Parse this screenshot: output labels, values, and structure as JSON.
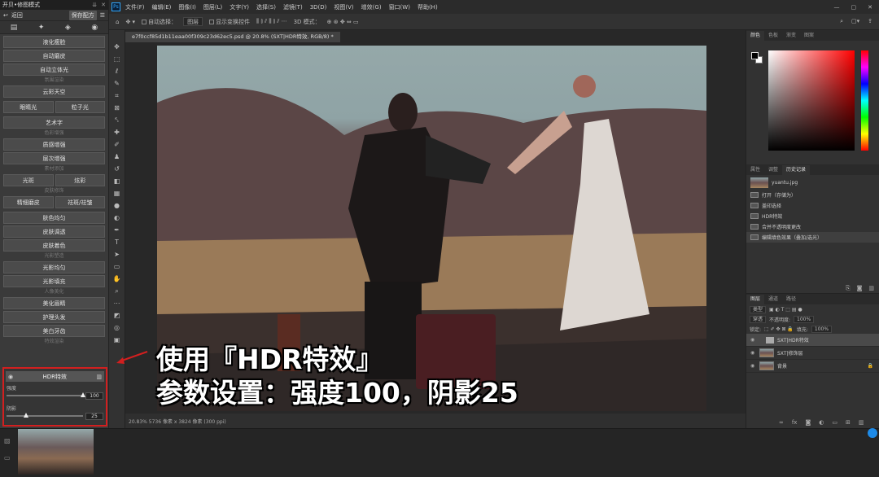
{
  "plugin": {
    "title": "开贝•修图模式",
    "back": "返回",
    "save": "保存配方",
    "buttons": {
      "liquify": "液化瘦脸",
      "auto_skin": "自动磨皮",
      "auto_3d": "自动立体光",
      "sec_atmosphere": "氛围渲染",
      "cloud_sky": "云彩天空",
      "eye_light": "眼睛光",
      "particle_light": "粒子光",
      "art_font": "艺术字",
      "sec_color": "色彩增强",
      "texture": "质感增强",
      "layer_enhance": "层次增强",
      "sec_material": "素材添加",
      "light_spot": "光斑",
      "confetti": "炫彩",
      "sec_skin": "皮肤修饰",
      "fine_skin": "精细磨皮",
      "remove_wrinkle": "祛斑/祛皱",
      "skin_even": "肤色均匀",
      "skin_tone": "皮肤调透",
      "skin_color": "皮肤着色",
      "sec_light": "光影塑造",
      "light_even": "光影均匀",
      "light_fill": "光影填充",
      "sec_portrait": "人像美化",
      "beautify_eyebrow": "美化眉睛",
      "hair_care": "护理头发",
      "whiten_teeth": "美白牙齿",
      "sec_effects": "特效渲染"
    },
    "hdr": {
      "title": "HDR特效",
      "strength_label": "强度",
      "strength_value": "100",
      "strength": 100,
      "shadow_label": "阴影",
      "shadow_value": "25",
      "shadow": 25
    }
  },
  "menu": {
    "items": [
      "文件(F)",
      "编辑(E)",
      "图像(I)",
      "图层(L)",
      "文字(Y)",
      "选择(S)",
      "滤镜(T)",
      "3D(D)",
      "视图(V)",
      "增效(G)",
      "窗口(W)",
      "帮助(H)"
    ]
  },
  "options": {
    "auto_select": "自动选择：",
    "group": "图层",
    "show_transform": "显示变换控件",
    "mode3d": "3D 模式："
  },
  "document": {
    "tab": "e7f0ccf85d1b11eaa00f309c23d62ec5.psd @ 20.8% (SXT|HDR特效, RGB/8) *",
    "status": "20.83%    5736 像素 x 3824 像素 (300 ppi)"
  },
  "caption": {
    "line1": "使用『HDR特效』",
    "line2": "参数设置：强度100，阴影25"
  },
  "panels": {
    "color_tabs": [
      "颜色",
      "色板",
      "渐变",
      "图案"
    ],
    "history_tabs": [
      "属性",
      "调整",
      "历史记录"
    ],
    "history_file": "yuantu.jpg",
    "history_items": [
      "打开（存储为）",
      "盖印选择",
      "HDR特效",
      "合并不透明度更改",
      "编辑填色效果（叠加/选光）"
    ],
    "layer_tabs": [
      "图层",
      "通道",
      "路径"
    ],
    "layer_kind": "类型",
    "blend": "穿透",
    "opacity_label": "不透明度:",
    "opacity": "100%",
    "lock_label": "锁定:",
    "fill_label": "填充:",
    "fill": "100%",
    "layers": [
      "SXT|HDR特效",
      "SXT|修饰层",
      "背景"
    ]
  }
}
